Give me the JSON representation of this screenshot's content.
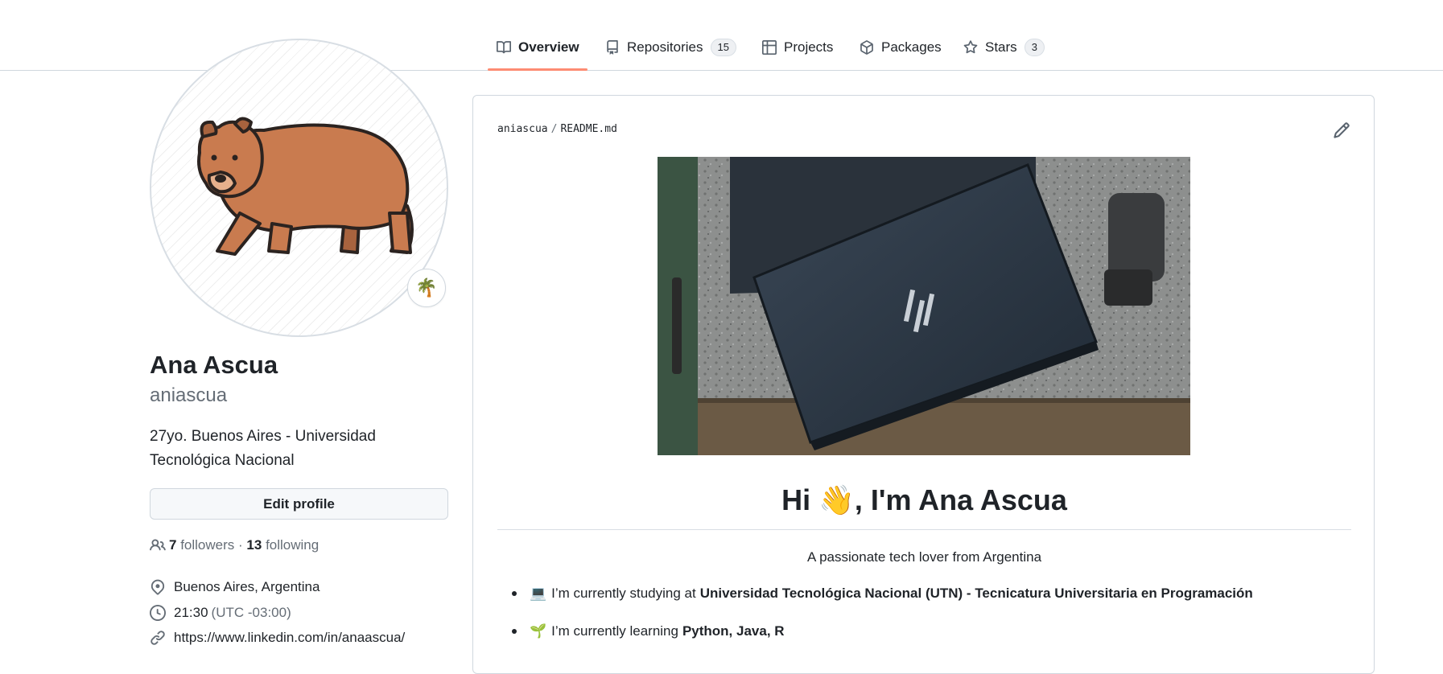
{
  "tabs": [
    {
      "label": "Overview",
      "icon": "book-icon",
      "active": true
    },
    {
      "label": "Repositories",
      "icon": "repo-icon",
      "count": "15"
    },
    {
      "label": "Projects",
      "icon": "table-icon"
    },
    {
      "label": "Packages",
      "icon": "package-icon"
    },
    {
      "label": "Stars",
      "icon": "star-icon",
      "count": "3"
    }
  ],
  "profile": {
    "status_emoji": "🌴",
    "name": "Ana Ascua",
    "login": "aniascua",
    "bio": "27yo. Buenos Aires - Universidad Tecnológica Nacional",
    "edit_label": "Edit profile",
    "followers_count": "7",
    "followers_label": "followers",
    "following_count": "13",
    "following_label": "following",
    "location": "Buenos Aires, Argentina",
    "local_time": "21:30",
    "timezone": "(UTC -03:00)",
    "website": "https://www.linkedin.com/in/anaascua/"
  },
  "readme": {
    "owner": "aniascua",
    "file": "README.md",
    "headline": "Hi 👋, I'm Ana Ascua",
    "tagline": "A passionate tech lover from Argentina",
    "bullets": [
      {
        "emoji": "💻",
        "text": "I’m currently studying at",
        "bold": "Universidad Tecnológica Nacional (UTN) - Tecnicatura Universitaria en Programación"
      },
      {
        "emoji": "🌱",
        "text": "I’m currently learning",
        "bold": "Python, Java, R"
      }
    ]
  },
  "colors": {
    "accent_underline": "#fd8c73",
    "text": "#1f2328",
    "muted": "#656d76",
    "border": "#d0d7de"
  }
}
